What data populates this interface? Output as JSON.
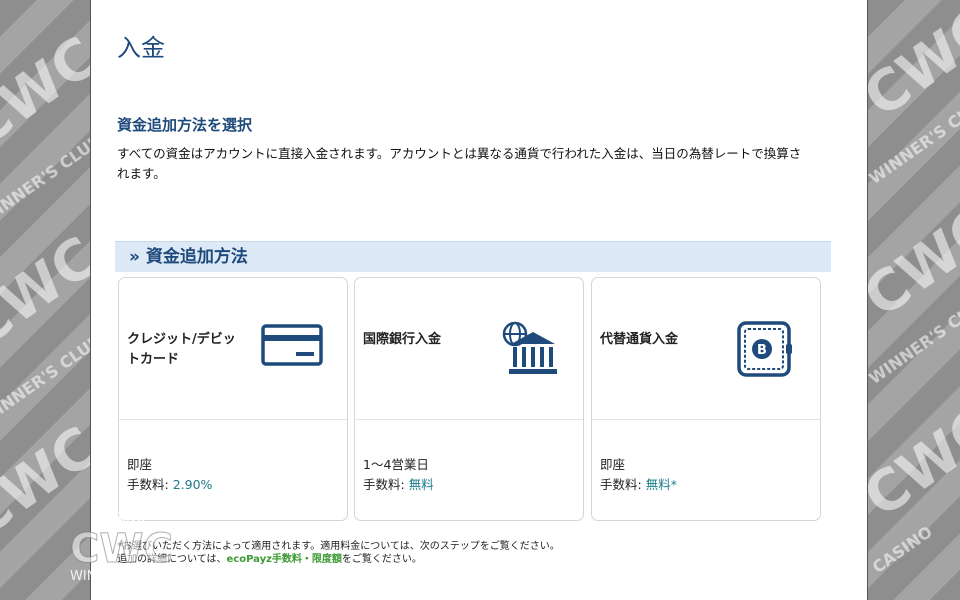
{
  "page": {
    "title": "入金"
  },
  "section": {
    "heading": "資金追加方法を選択",
    "description": "すべての資金はアカウントに直接入金されます。アカウントとは異なる通貨で行われた入金は、当日の為替レートで換算されます。"
  },
  "methods_header": {
    "label": "» 資金追加方法"
  },
  "methods": [
    {
      "name": "クレジット/デビットカード",
      "icon": "credit-card-icon",
      "time": "即座",
      "fee_label": "手数料:",
      "fee_value": "2.90%"
    },
    {
      "name": "国際銀行入金",
      "icon": "bank-icon",
      "time": "1～4営業日",
      "fee_label": "手数料:",
      "fee_value": "無料"
    },
    {
      "name": "代替通貨入金",
      "icon": "bitcoin-wallet-icon",
      "time": "即座",
      "fee_label": "手数料:",
      "fee_value": "無料*"
    }
  ],
  "footnote": {
    "line1": "*お選びいただく方法によって適用されます。適用料金については、次のステップをご覧ください。",
    "line2_prefix": "追加の詳細については、",
    "link": "ecoPayz手数料・限度額",
    "line2_suffix": "をご覧ください。"
  },
  "watermark": {
    "casino": "CASINO",
    "brand": "CWC",
    "tagline": "WINNER'S CLUB"
  },
  "colors": {
    "title_blue": "#1f4a7c",
    "header_bg": "#dde9f6",
    "link_green": "#3d9b35",
    "icon_blue": "#1f4a7c"
  }
}
